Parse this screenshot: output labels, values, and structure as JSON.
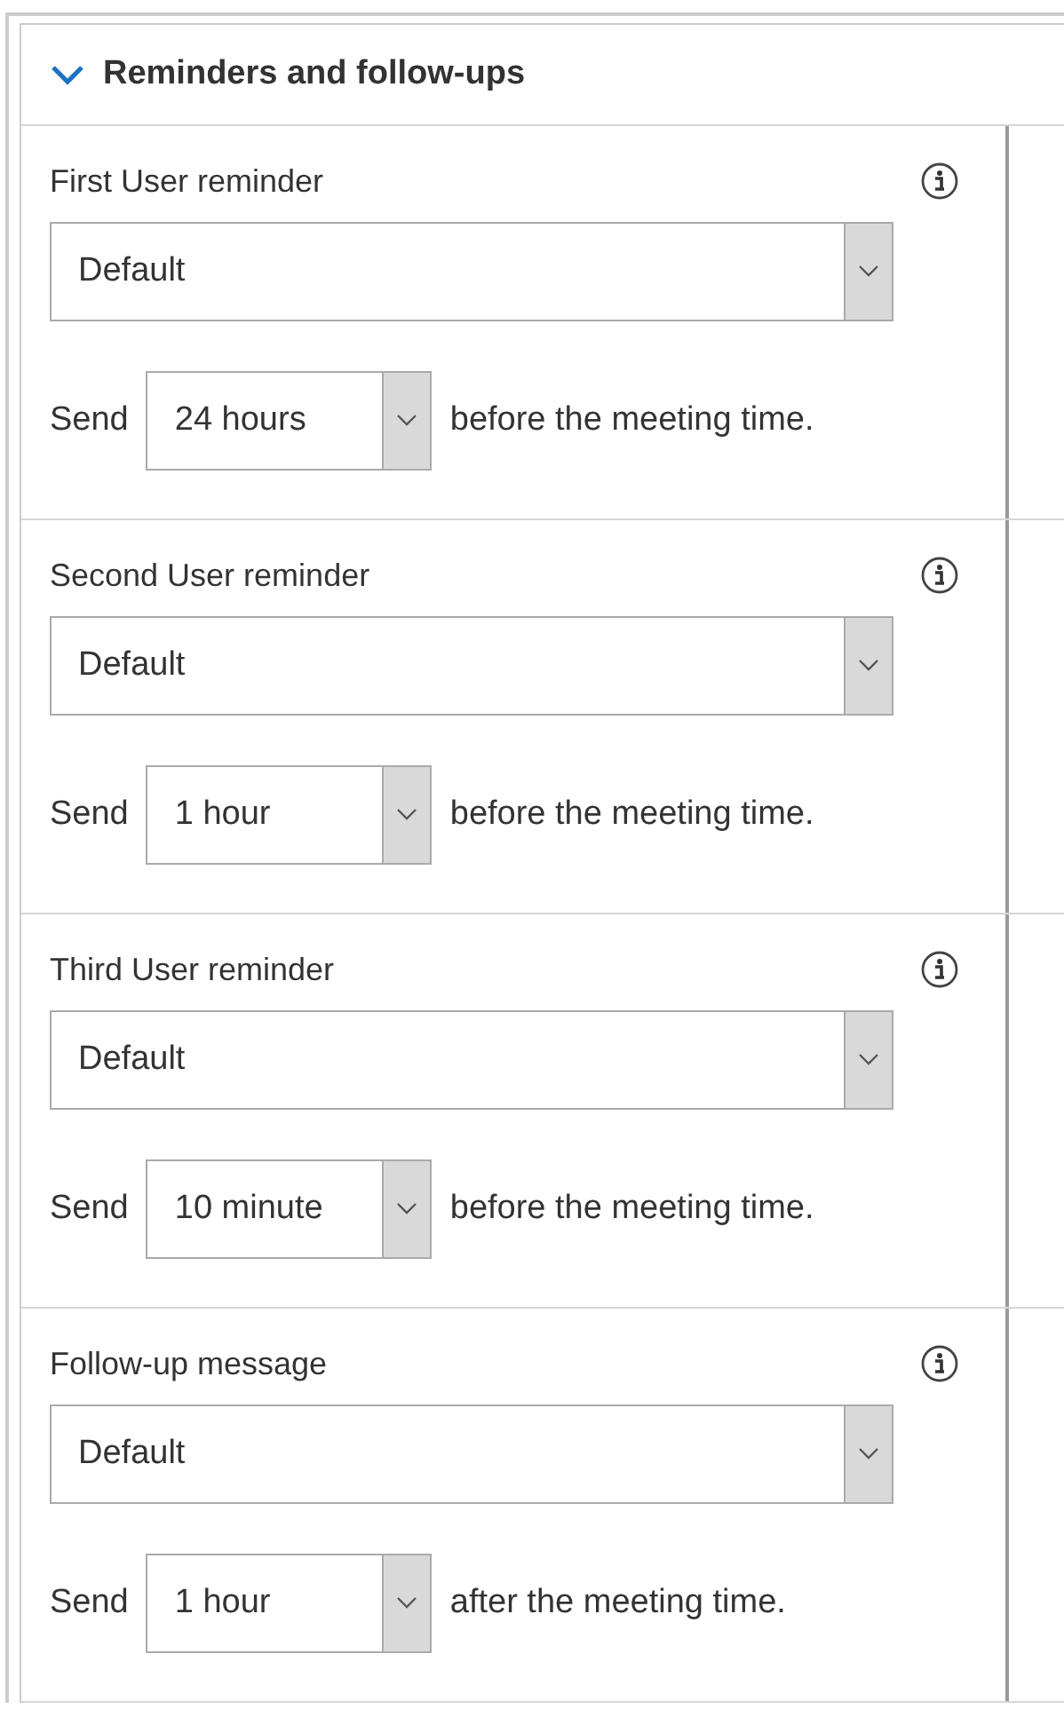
{
  "panel": {
    "title": "Reminders and follow-ups",
    "expanded": true
  },
  "sections": [
    {
      "label": "First User reminder",
      "template": "Default",
      "send_label": "Send",
      "offset": "24 hours",
      "suffix": "before the meeting time."
    },
    {
      "label": "Second User reminder",
      "template": "Default",
      "send_label": "Send",
      "offset": "1 hour",
      "suffix": "before the meeting time."
    },
    {
      "label": "Third User reminder",
      "template": "Default",
      "send_label": "Send",
      "offset": "10 minute",
      "suffix": "before the meeting time."
    },
    {
      "label": "Follow-up message",
      "template": "Default",
      "send_label": "Send",
      "offset": "1 hour",
      "suffix": "after the meeting time."
    }
  ]
}
